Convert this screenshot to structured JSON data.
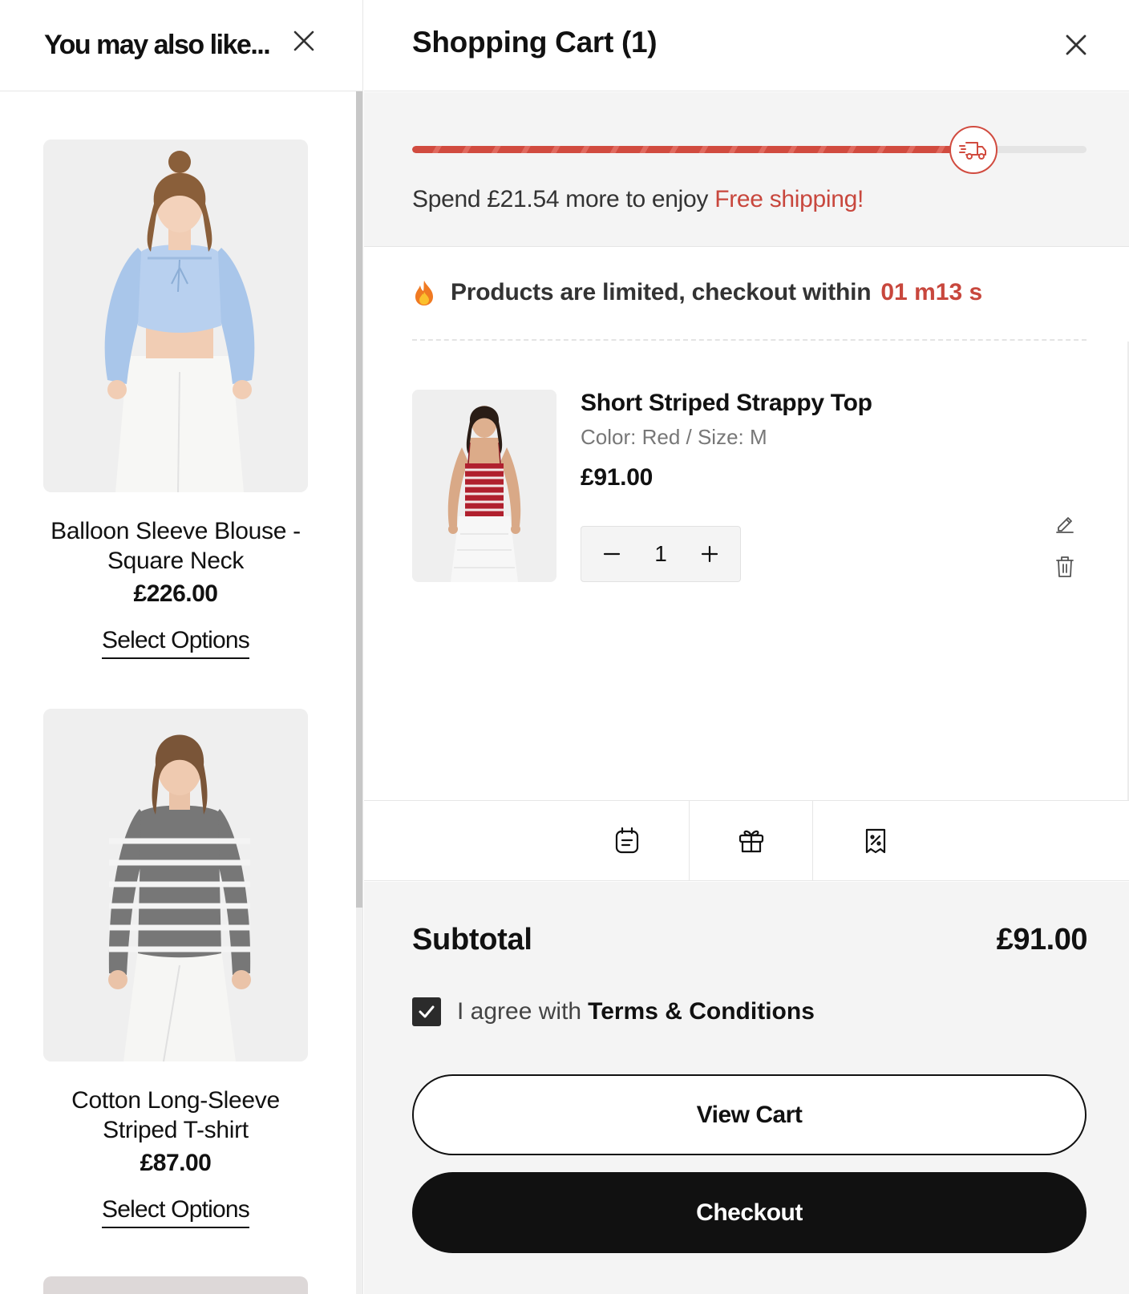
{
  "recommendations": {
    "title": "You may also like...",
    "items": [
      {
        "name": "Balloon Sleeve Blouse - Square Neck",
        "price": "£226.00",
        "action": "Select Options"
      },
      {
        "name": "Cotton Long-Sleeve Striped T-shirt",
        "price": "£87.00",
        "action": "Select Options"
      }
    ]
  },
  "cart": {
    "title": "Shopping Cart (1)",
    "shipping": {
      "progress": 0.84,
      "text_prefix": "Spend £21.54 more to enjoy",
      "text_highlight": "Free shipping!"
    },
    "limited": {
      "text": "Products are limited, checkout within",
      "time": "01 m13 s"
    },
    "items": [
      {
        "name": "Short Striped Strappy Top",
        "variant": "Color: Red /  Size: M",
        "price": "£91.00",
        "quantity": "1"
      }
    ],
    "tools": [
      "note-icon",
      "gift-icon",
      "coupon-icon"
    ],
    "subtotal_label": "Subtotal",
    "subtotal_value": "£91.00",
    "agree_text": "I agree with",
    "agree_link": "Terms & Conditions",
    "agree_checked": true,
    "view_cart_label": "View Cart",
    "checkout_label": "Checkout"
  },
  "colors": {
    "accent": "#c8473d",
    "primary": "#111111",
    "panel_bg": "#f4f4f4"
  }
}
